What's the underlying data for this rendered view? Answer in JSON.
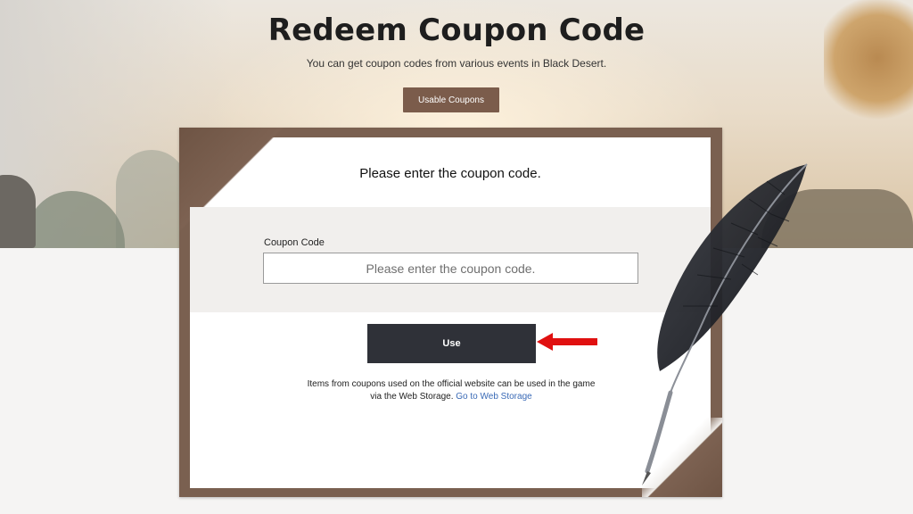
{
  "page": {
    "title": "Redeem Coupon Code",
    "subtitle": "You can get coupon codes from various events in Black Desert.",
    "usable_coupons_label": "Usable Coupons"
  },
  "card": {
    "heading": "Please enter the coupon code.",
    "field_label": "Coupon Code",
    "input_placeholder": "Please enter the coupon code.",
    "input_value": "",
    "use_label": "Use",
    "note_line1": "Items from coupons used on the official website can be used in the game",
    "note_line2": "via the Web Storage.",
    "note_link": "Go to Web Storage"
  },
  "colors": {
    "accent_brown": "#7b5c4b",
    "frame_brown": "#7a6050",
    "use_button": "#2f3138",
    "link_blue": "#3a6ab6",
    "arrow_red": "#e01010"
  },
  "icons": {
    "arrow": "red-left-arrow",
    "decoration": "quill-pen"
  }
}
